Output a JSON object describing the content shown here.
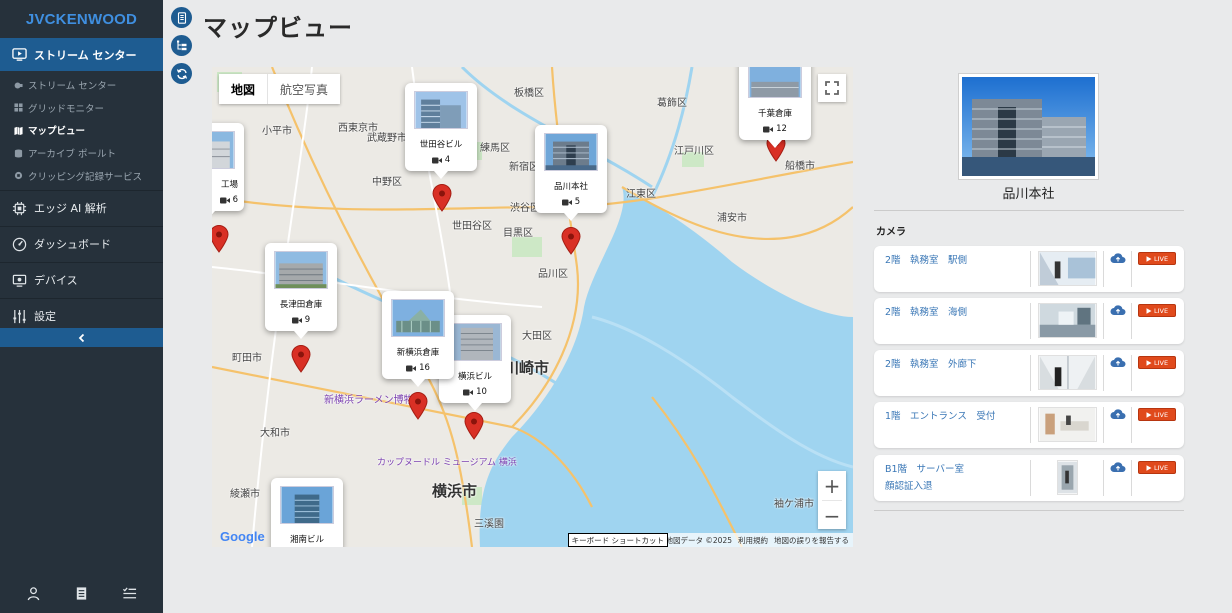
{
  "brand": "JVCKENWOOD",
  "sidebar": {
    "main_item": "ストリーム センター",
    "sub_items": [
      {
        "label": "ストリーム センター",
        "icon": "stream-icon"
      },
      {
        "label": "グリッドモニター",
        "icon": "grid-icon"
      },
      {
        "label": "マップビュー",
        "icon": "map-icon"
      },
      {
        "label": "アーカイブ ポールト",
        "icon": "archive-icon"
      },
      {
        "label": "クリッピング記録サービス",
        "icon": "clip-icon"
      }
    ],
    "groups": [
      {
        "label": "エッジ AI 解析",
        "icon": "chip-icon"
      },
      {
        "label": "ダッシュボード",
        "icon": "gauge-icon"
      },
      {
        "label": "デバイス",
        "icon": "device-icon"
      },
      {
        "label": "設定",
        "icon": "sliders-icon"
      }
    ]
  },
  "page": {
    "title": "マップビュー"
  },
  "map": {
    "type_map": "地図",
    "type_satellite": "航空写真",
    "google": "Google",
    "keyboard": "キーボード ショートカット",
    "attrib_data": "地図データ ©2025",
    "attrib_terms": "利用規約",
    "attrib_report": "地図の誤りを報告する",
    "zoom_in": "+",
    "zoom_out": "−",
    "labels": {
      "itabashi": "板橋区",
      "katsushika": "葛飾区",
      "nishitokyo": "西東京市",
      "musashino": "武蔵野市",
      "kodaira": "小平市",
      "nerima": "練馬区",
      "nakano": "中野区",
      "shinjuku": "新宿区",
      "edogawa": "江戸川区",
      "funabashi": "船橋市",
      "koto": "江東区",
      "shibuya": "渋谷区",
      "setagaya": "世田谷区",
      "meguro": "目黒区",
      "urayasu": "浦安市",
      "shinagawa": "品川区",
      "ota": "大田区",
      "kawasaki": "川崎市",
      "machida": "町田市",
      "yokohama": "横浜市",
      "yamato": "大和市",
      "ramen": "新横浜ラーメン博物館",
      "cupnoodle": "カップヌードル ミュージアム 横浜",
      "sankeien": "三溪園",
      "sodegaura": "袖ケ浦市",
      "ayase": "綾瀬市"
    }
  },
  "sites": [
    {
      "name": "世田谷ビル",
      "count": "4"
    },
    {
      "name": "品川本社",
      "count": "5"
    },
    {
      "name": "千葉倉庫",
      "count": "12"
    },
    {
      "name": "長津田倉庫",
      "count": "9"
    },
    {
      "name": "新横浜倉庫",
      "count": "16"
    },
    {
      "name": "横浜ビル",
      "count": "10"
    },
    {
      "name": "湘南ビル",
      "count": ""
    },
    {
      "name": "工場",
      "count": "6"
    }
  ],
  "detail": {
    "site_name": "品川本社",
    "camera_heading": "カメラ",
    "live_label": "LIVE",
    "cameras": [
      {
        "name": "2階　執務室　駅側"
      },
      {
        "name": "2階　執務室　海側"
      },
      {
        "name": "2階　執務室　外廊下"
      },
      {
        "name": "1階　エントランス　受付"
      },
      {
        "name": "B1階　サーバー室\n顔認証入退"
      }
    ]
  },
  "colors": {
    "accent": "#1e5c91",
    "sidebar": "#26313b",
    "live": "#e04a1c",
    "pin": "#d93025",
    "brand": "#3f8fe0"
  }
}
